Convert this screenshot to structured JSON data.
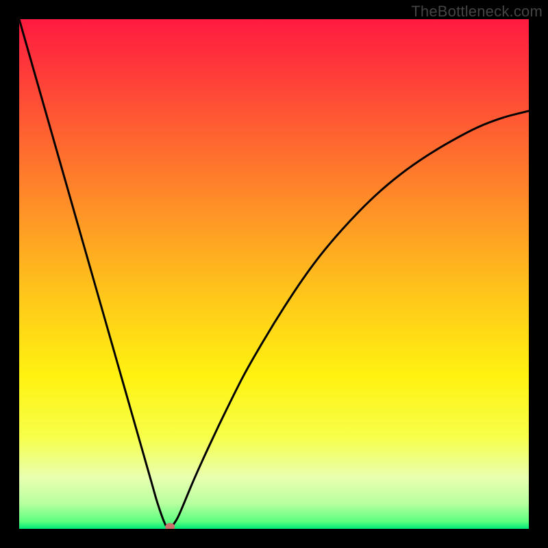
{
  "watermark": "TheBottleneck.com",
  "chart_data": {
    "type": "line",
    "title": "",
    "xlabel": "",
    "ylabel": "",
    "xlim": [
      0,
      100
    ],
    "ylim": [
      0,
      100
    ],
    "grid": false,
    "series": [
      {
        "name": "bottleneck-curve",
        "x": [
          0,
          2,
          4,
          6,
          8,
          10,
          12,
          14,
          16,
          18,
          20,
          22,
          24,
          26,
          27,
          28,
          28.6,
          29,
          29.5,
          30,
          31,
          32,
          34,
          36,
          38,
          40,
          44,
          48,
          52,
          56,
          60,
          65,
          70,
          75,
          80,
          85,
          90,
          95,
          100
        ],
        "values": [
          100,
          93,
          86,
          79,
          72,
          65,
          58,
          51,
          44,
          37,
          30,
          23,
          16,
          9,
          5.5,
          2.5,
          1,
          0.3,
          0,
          0.5,
          2,
          4.2,
          9,
          13.5,
          17.8,
          22,
          30,
          37,
          43.5,
          49.5,
          54.8,
          60.5,
          65.5,
          69.7,
          73.2,
          76.2,
          78.8,
          80.7,
          82
        ]
      }
    ],
    "marker": {
      "x": 29.6,
      "y": 0
    },
    "gradient_stops": [
      {
        "offset": 0.0,
        "color": "#ff1a3f"
      },
      {
        "offset": 0.1,
        "color": "#ff3a3a"
      },
      {
        "offset": 0.25,
        "color": "#ff6a2f"
      },
      {
        "offset": 0.4,
        "color": "#ff9a25"
      },
      {
        "offset": 0.55,
        "color": "#ffc91a"
      },
      {
        "offset": 0.7,
        "color": "#fff210"
      },
      {
        "offset": 0.82,
        "color": "#f7ff4a"
      },
      {
        "offset": 0.9,
        "color": "#e8ffb0"
      },
      {
        "offset": 0.95,
        "color": "#b8ffa0"
      },
      {
        "offset": 0.985,
        "color": "#5fff80"
      },
      {
        "offset": 1.0,
        "color": "#00e878"
      }
    ]
  }
}
